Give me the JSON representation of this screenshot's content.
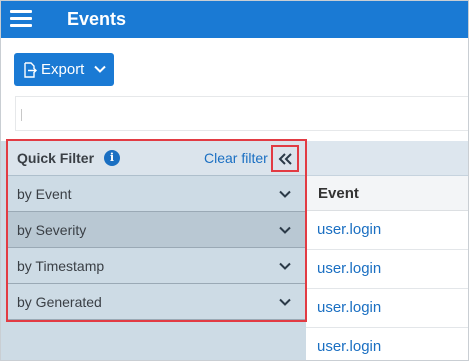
{
  "header": {
    "title": "Events",
    "menu_icon": "hamburger-menu-icon"
  },
  "toolbar": {
    "export_label": "Export",
    "export_icon": "export-file-icon",
    "dropdown_icon": "chevron-down-icon"
  },
  "search": {
    "value": ""
  },
  "quick_filter": {
    "title": "Quick Filter",
    "info_icon": "info-icon",
    "clear_label": "Clear filter",
    "collapse_icon": "double-chevron-left-icon",
    "items": [
      {
        "label": "by Event"
      },
      {
        "label": "by Severity"
      },
      {
        "label": "by Timestamp"
      },
      {
        "label": "by Generated"
      }
    ]
  },
  "grid": {
    "columns": [
      "Event"
    ],
    "rows": [
      "user.login",
      "user.login",
      "user.login",
      "user.login"
    ]
  },
  "colors": {
    "accent": "#1a7ad4",
    "highlight_outline": "#e23b43",
    "panel_bg": "#cddbe5",
    "link": "#1a6fc2"
  }
}
